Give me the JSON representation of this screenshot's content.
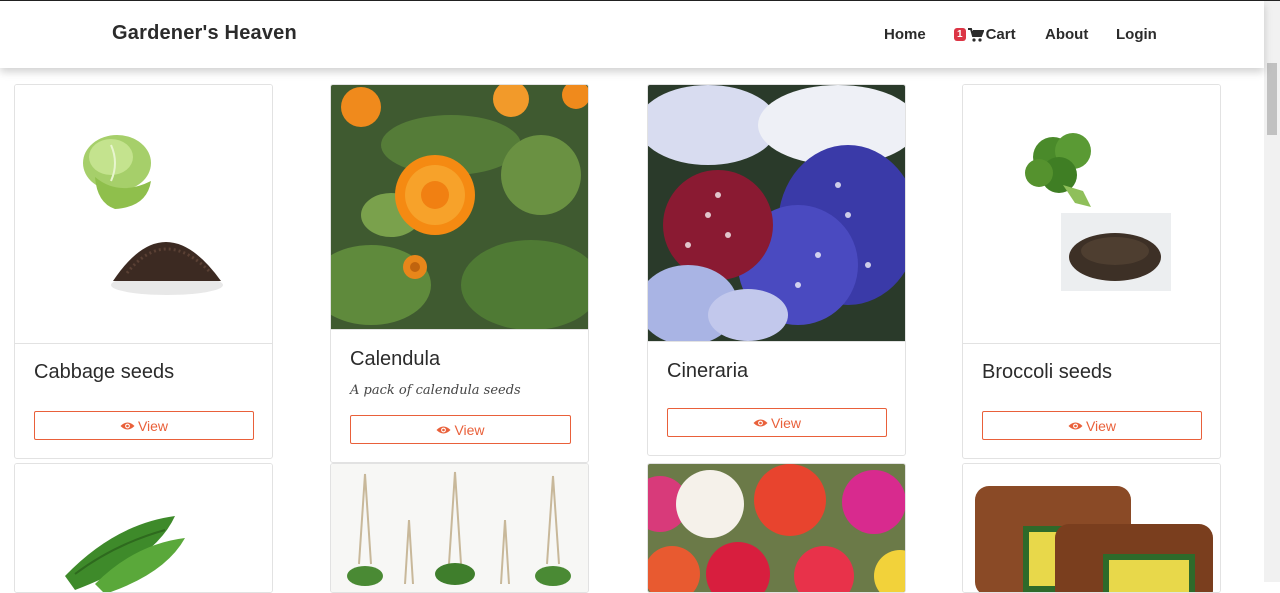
{
  "brand": "Gardener's Heaven",
  "nav": {
    "home": "Home",
    "cart_count": "1",
    "cart": "Cart",
    "about": "About",
    "login": "Login"
  },
  "products": [
    {
      "title": "Cabbage seeds",
      "description": "",
      "button": "View"
    },
    {
      "title": "Calendula",
      "description": "A pack of calendula seeds",
      "button": "View"
    },
    {
      "title": "Cineraria",
      "description": "",
      "button": "View"
    },
    {
      "title": "Broccoli seeds",
      "description": "",
      "button": "View"
    }
  ],
  "colors": {
    "accent": "#e9603a",
    "badge": "#dc3545"
  }
}
